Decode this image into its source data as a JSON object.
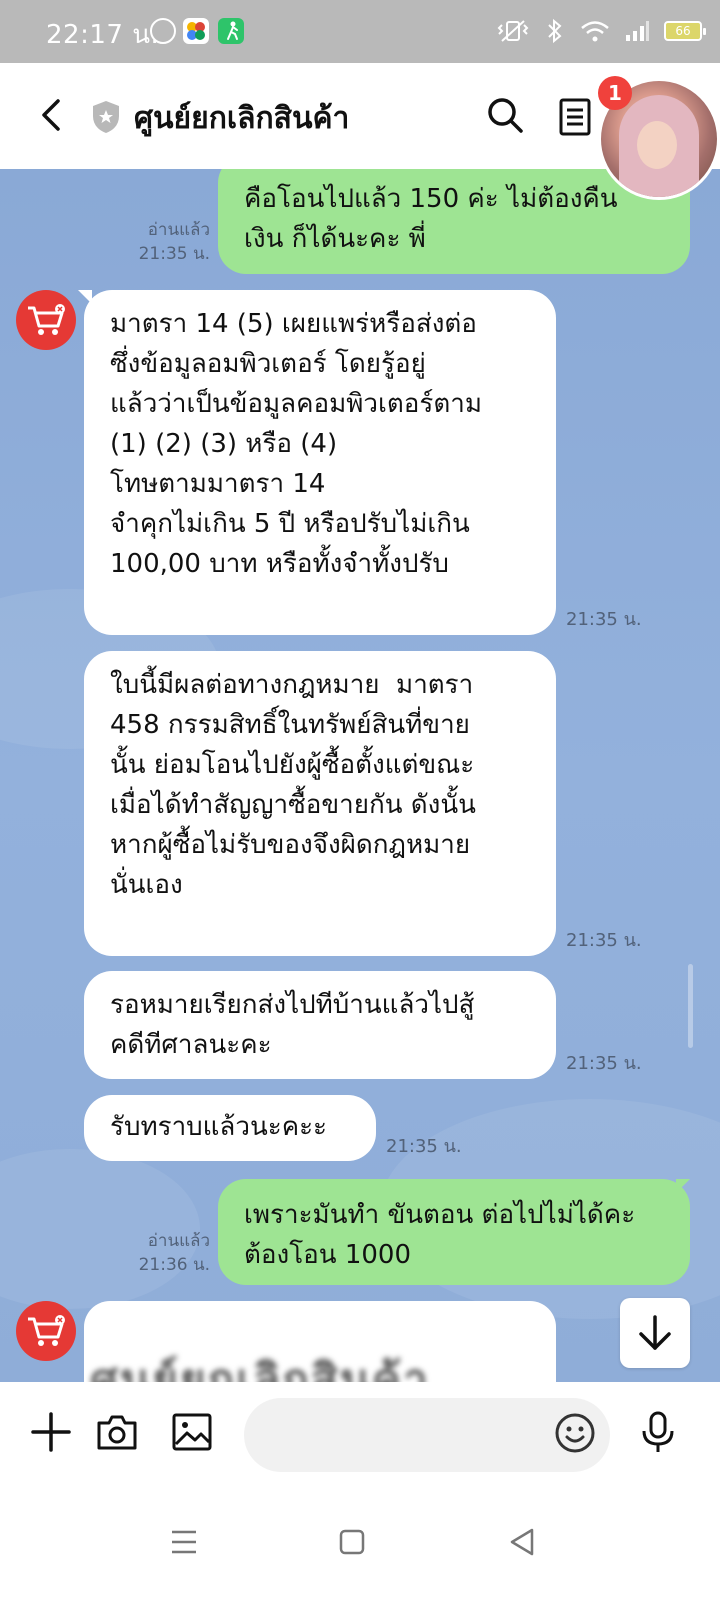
{
  "status_bar": {
    "time": "22:17 น.",
    "battery": "66"
  },
  "header": {
    "title": "ศูนย์ยกเลิกสินค้า",
    "notification_count": "1"
  },
  "messages": [
    {
      "id": "m1",
      "direction": "out",
      "text": "คือโอนไปแล้ว 150 ค่ะ ไม่ต้องคืน\nเงิน ก็ได้นะคะ พี่",
      "read_label": "อ่านแล้ว",
      "time": "21:35 น."
    },
    {
      "id": "m2",
      "direction": "in",
      "text": "มาตรา 14 (5) เผยแพร่หรือส่งต่อ\nซึ่งข้อมูลอมพิวเตอร์ โดยรู้อยู่\nแล้วว่าเป็นข้อมูลคอมพิวเตอร์ตาม\n(1) (2) (3) หรือ (4)\nโทษตามมาตรา 14\nจำคุกไม่เกิน 5 ปี หรือปรับไม่เกิน\n100,00 บาท หรือทั้งจำทั้งปรับ",
      "time": "21:35 น."
    },
    {
      "id": "m3",
      "direction": "in",
      "text": "ใบนี้มีผลต่อทางกฎหมาย  มาตรา\n458 กรรมสิทธิ์ในทรัพย์สินที่ขาย\nนั้น ย่อมโอนไปยังผู้ซื้อตั้งแต่ขณะ\nเมื่อได้ทำสัญญาซื้อขายกัน ดังนั้น\nหากผู้ซื้อไม่รับของจึงผิดกฎหมาย\nนั่นเอง",
      "time": "21:35 น."
    },
    {
      "id": "m4",
      "direction": "in",
      "text": "รอหมายเรียกส่งไปทีบ้านแล้วไปสู้\nคดีทีศาลนะคะ",
      "time": "21:35 น."
    },
    {
      "id": "m5",
      "direction": "in",
      "text": "รับทราบแล้วนะคะะ",
      "time": "21:35 น."
    },
    {
      "id": "m6",
      "direction": "out",
      "text": "เพราะมันทำ ขันตอน ต่อไปไม่ได้คะ\nต้องโอน 1000",
      "read_label": "อ่านแล้ว",
      "time": "21:36 น."
    }
  ],
  "image_message": {
    "blurred_text": "ศูนย์ยกเลิกสินค้า"
  },
  "input": {
    "placeholder": ""
  },
  "colors": {
    "outgoing_bubble": "#9ee493",
    "incoming_bubble": "#ffffff",
    "chat_background": "#8fadd8",
    "badge": "#f0413c",
    "sender_avatar": "#e53935"
  }
}
